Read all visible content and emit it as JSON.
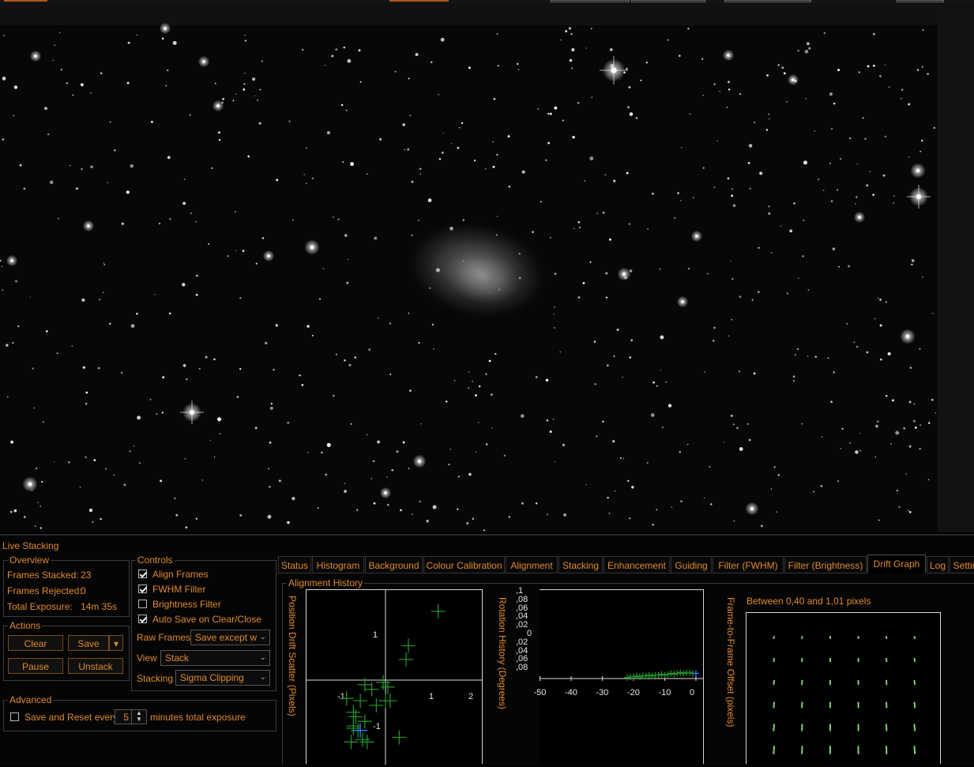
{
  "panel": {
    "title": "Live Stacking"
  },
  "overview": {
    "title": "Overview",
    "frames_stacked_label": "Frames Stacked:",
    "frames_stacked": "23",
    "frames_rejected_label": "Frames Rejected:",
    "frames_rejected": "0",
    "total_exposure_label": "Total Exposure:",
    "total_exposure": "14m 35s"
  },
  "actions": {
    "title": "Actions",
    "clear": "Clear",
    "save": "Save",
    "pause": "Pause",
    "unstack": "Unstack",
    "save_arrow": "▾"
  },
  "controls": {
    "title": "Controls",
    "align_frames": {
      "label": "Align Frames",
      "checked": true
    },
    "fwhm_filter": {
      "label": "FWHM Filter",
      "checked": true
    },
    "brightness_filter": {
      "label": "Brightness Filter",
      "checked": false
    },
    "auto_save": {
      "label": "Auto Save on Clear/Close",
      "checked": true
    },
    "raw_frames_label": "Raw Frames",
    "raw_frames_value": "Save except w",
    "view_label": "View",
    "view_value": "Stack",
    "stacking_label": "Stacking",
    "stacking_value": "Sigma Clipping"
  },
  "advanced": {
    "title": "Advanced",
    "save_reset_label": "Save and Reset every",
    "minutes_value": "5",
    "minutes_suffix": "minutes total exposure"
  },
  "tabs": [
    "Status",
    "Histogram",
    "Background",
    "Colour Calibration",
    "Alignment",
    "Stacking",
    "Enhancement",
    "Guiding",
    "Filter (FWHM)",
    "Filter (Brightness)",
    "Drift Graph",
    "Log",
    "Settin"
  ],
  "active_tab": "Drift Graph",
  "drift": {
    "group_title": "Alignment History",
    "scatter_label": "Position Drift Scatter (Pixels)",
    "rotation_label": "Rotation History (Degrees)",
    "offset_label": "Frame-to-Frame Offset (pixels)",
    "offset_caption": "Between 0,40 and 1,01 pixels",
    "scatter_ticks": {
      "x1": "1",
      "x2": "2",
      "xm1": "-1",
      "y1": "1",
      "ym1": "-1"
    },
    "rotation_yticks": [
      ",1",
      ",08",
      ",06",
      ",04",
      ",02",
      "0",
      ",02",
      ",04",
      ",06",
      ",08"
    ],
    "rotation_xticks": [
      "-50",
      "-40",
      "-30",
      "-20",
      "-10",
      "0"
    ]
  },
  "colors": {
    "accent": "#e08a2c",
    "series_green": "#1f8f2a",
    "current_blue": "#3a78ff",
    "arrow_green": "#7bd36a"
  },
  "chart_data": [
    {
      "type": "scatter",
      "title": "",
      "ylabel": "Position Drift Scatter (Pixels)",
      "xlim": [
        -2,
        2
      ],
      "ylim": [
        -1.6,
        2
      ],
      "series": [
        {
          "name": "",
          "x": [
            1.15,
            0.5,
            0.45,
            -0.45,
            -0.3,
            -0.05,
            0.05,
            0.0,
            -0.55,
            -0.2,
            0.1,
            -0.85,
            -0.7,
            -0.65,
            -0.7,
            -0.6,
            -0.5,
            -0.75,
            -0.4,
            0.3,
            -0.7,
            -0.45
          ],
          "y": [
            1.5,
            0.75,
            0.45,
            -0.1,
            -0.2,
            -0.05,
            -0.15,
            -0.45,
            -0.45,
            -0.55,
            -0.45,
            -0.4,
            -0.7,
            -0.8,
            -1.05,
            -1.1,
            -1.3,
            -1.35,
            -1.35,
            -1.25,
            -1.0,
            -0.9
          ]
        }
      ],
      "current_point": {
        "x": -0.55,
        "y": -1.1
      }
    },
    {
      "type": "scatter",
      "title": "",
      "ylabel": "Rotation History (Degrees)",
      "xlim": [
        -50,
        0
      ],
      "ylim": [
        -0.1,
        0.1
      ],
      "series": [
        {
          "name": "",
          "x": [
            -22,
            -21,
            -20,
            -19,
            -18,
            -17,
            -16,
            -15,
            -14,
            -13,
            -12,
            -11,
            -10,
            -9,
            -8,
            -7,
            -6,
            -5,
            -4,
            -3,
            -2,
            -1
          ],
          "y": [
            0.001,
            0.002,
            0.002,
            0.003,
            0.002,
            0.003,
            0.003,
            0.004,
            0.003,
            0.004,
            0.004,
            0.005,
            0.004,
            0.005,
            0.006,
            0.005,
            0.006,
            0.007,
            0.006,
            0.007,
            0.007,
            0.006
          ]
        }
      ],
      "current_point": {
        "x": 0,
        "y": 0.006
      }
    }
  ]
}
